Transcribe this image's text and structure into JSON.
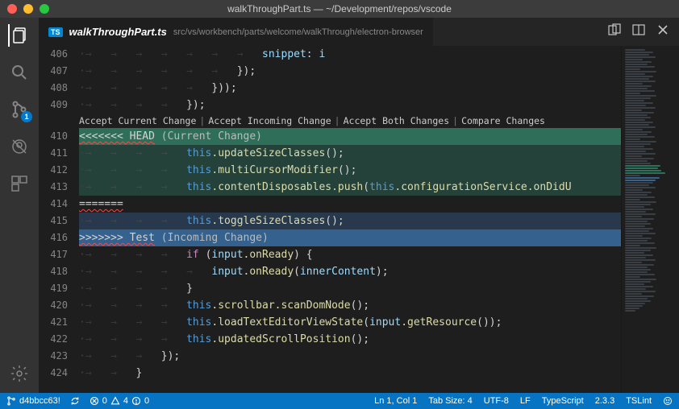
{
  "window": {
    "title": "walkThroughPart.ts — ~/Development/repos/vscode"
  },
  "tab": {
    "badge": "TS",
    "filename": "walkThroughPart.ts",
    "path": "src/vs/workbench/parts/welcome/walkThrough/electron-browser"
  },
  "scm_badge": "1",
  "codelens": {
    "accept_current": "Accept Current Change",
    "accept_incoming": "Accept Incoming Change",
    "accept_both": "Accept Both Changes",
    "compare": "Compare Changes"
  },
  "conflict": {
    "head_marker": "<<<<<<< HEAD",
    "head_label": "(Current Change)",
    "sep_marker": "=======",
    "tail_marker": ">>>>>>> Test",
    "tail_label": "(Incoming Change)"
  },
  "lines": {
    "l406": "snippet: i",
    "l411": ".updateSizeClasses",
    "l412": ".multiCursorModifier",
    "l413a": ".contentDisposables.push",
    "l413b": ".configurationService.onDidU",
    "l415": ".toggleSizeClasses",
    "l417a": "input",
    "l417b": ".onReady",
    "l418a": "input",
    "l418b": ".onReady",
    "l418c": "innerContent",
    "l420a": ".scrollbar.scanDomNode",
    "l421a": ".loadTextEditorViewState",
    "l421b": "input",
    "l421c": ".getResource",
    "l422": ".updatedScrollPosition"
  },
  "gutters": [
    "406",
    "407",
    "408",
    "409",
    "410",
    "411",
    "412",
    "413",
    "414",
    "415",
    "416",
    "417",
    "418",
    "419",
    "420",
    "421",
    "422",
    "423",
    "424"
  ],
  "status": {
    "branch": "d4bbcc63!",
    "errors": "0",
    "warnings": "4",
    "info": "0",
    "lncol": "Ln 1, Col 1",
    "tabsize": "Tab Size: 4",
    "encoding": "UTF-8",
    "eol": "LF",
    "lang": "TypeScript",
    "tsver": "2.3.3",
    "lint": "TSLint"
  }
}
